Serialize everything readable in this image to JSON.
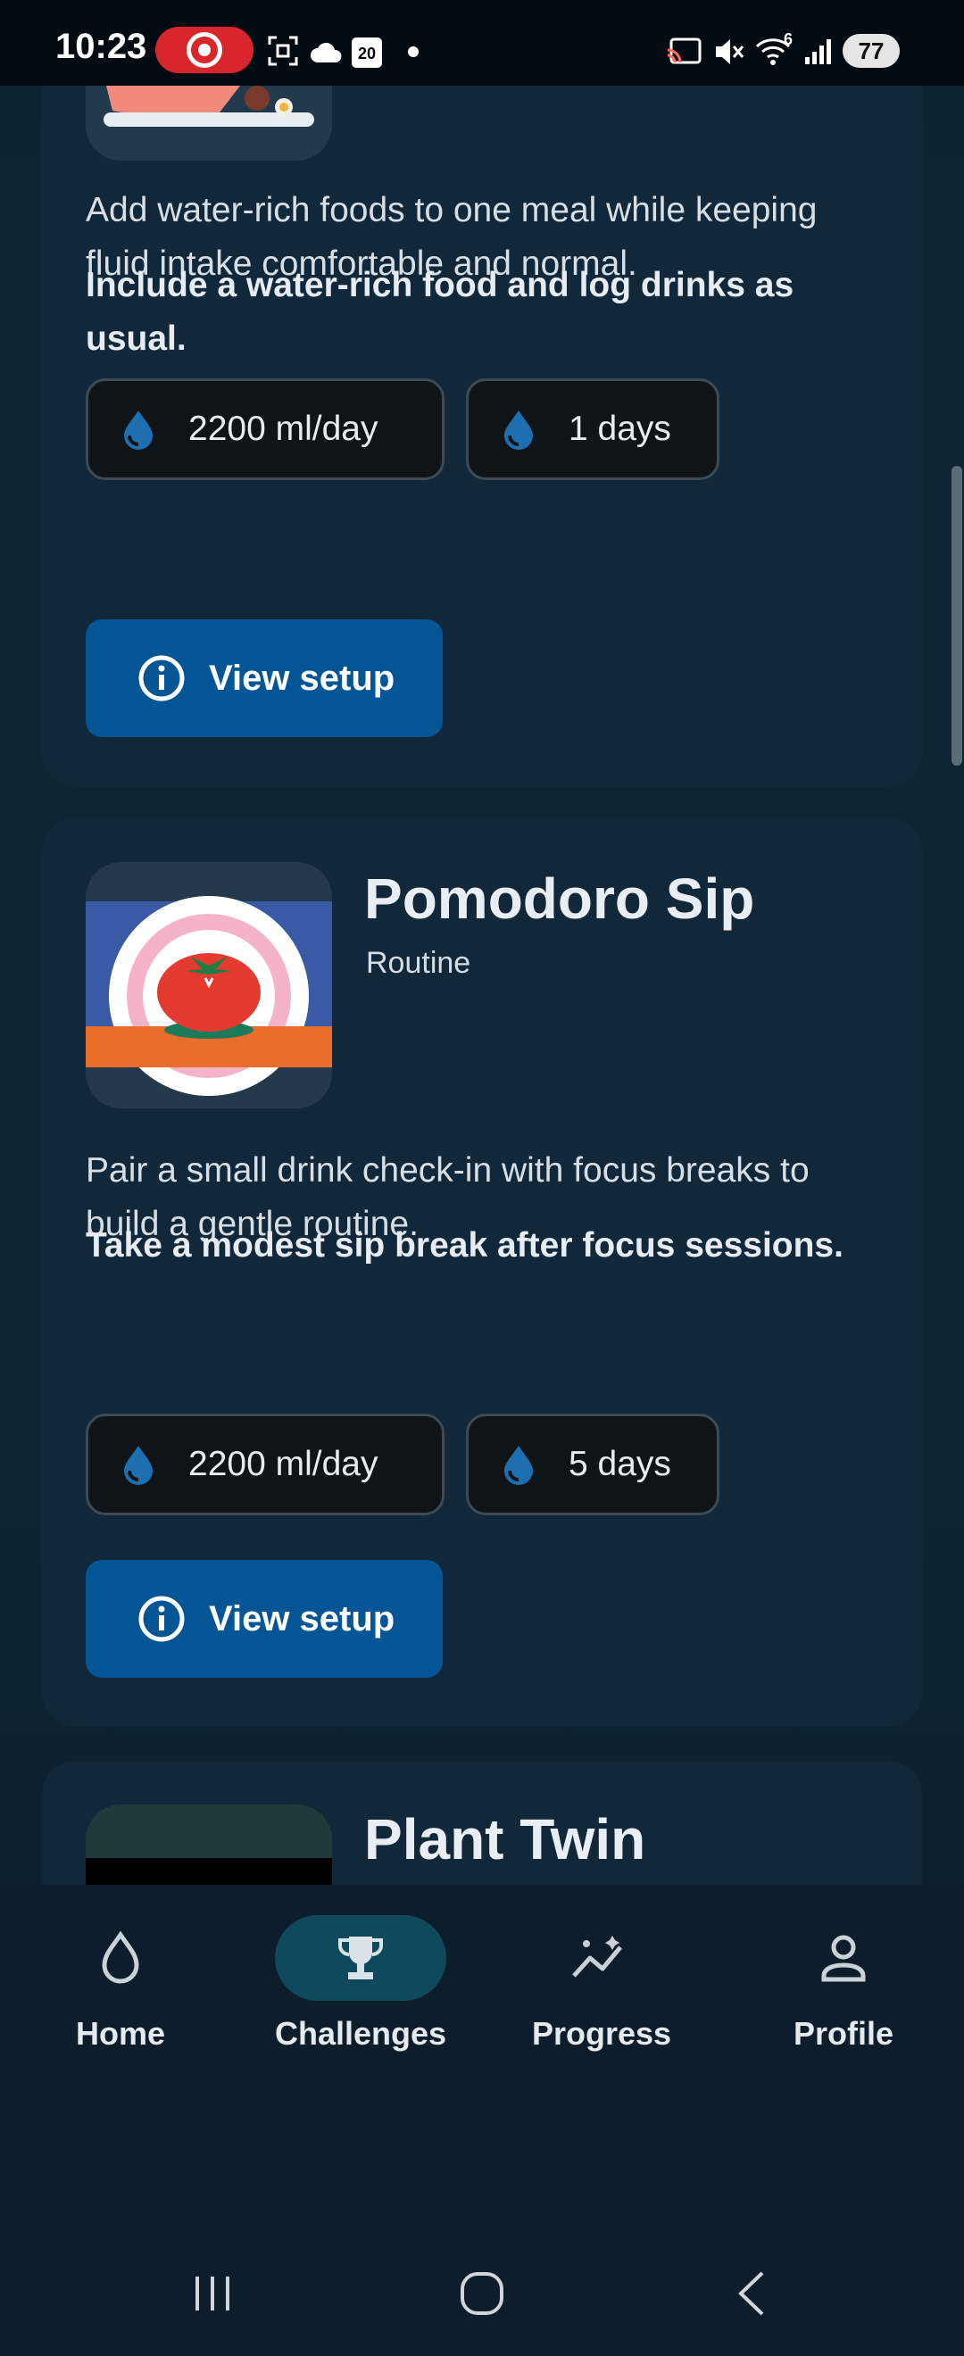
{
  "status_bar": {
    "time": "10:23",
    "battery": "77",
    "calendar_day": "20",
    "signal_label": "6"
  },
  "cards": [
    {
      "description": "Add water-rich foods to one meal while keeping fluid intake comfortable and normal.",
      "goal": "Include a water-rich food and log drinks as usual.",
      "chips": [
        "2200 ml/day",
        "1 days"
      ],
      "button_label": "View setup"
    },
    {
      "title": "Pomodoro Sip",
      "category": "Routine",
      "description": "Pair a small drink check-in with focus breaks to build a gentle routine.",
      "goal": "Take a modest sip break after focus sessions.",
      "chips": [
        "2200 ml/day",
        "5 days"
      ],
      "button_label": "View setup"
    },
    {
      "title": "Plant Twin"
    }
  ],
  "bottom_nav": {
    "items": [
      {
        "label": "Home",
        "icon": "droplet-icon",
        "active": false
      },
      {
        "label": "Challenges",
        "icon": "trophy-icon",
        "active": true
      },
      {
        "label": "Progress",
        "icon": "trend-icon",
        "active": false
      },
      {
        "label": "Profile",
        "icon": "person-icon",
        "active": false
      }
    ]
  },
  "colors": {
    "accent_button": "#035595",
    "active_nav_pill": "#0f4a5c",
    "drop_icon": "#1d6fb0"
  }
}
